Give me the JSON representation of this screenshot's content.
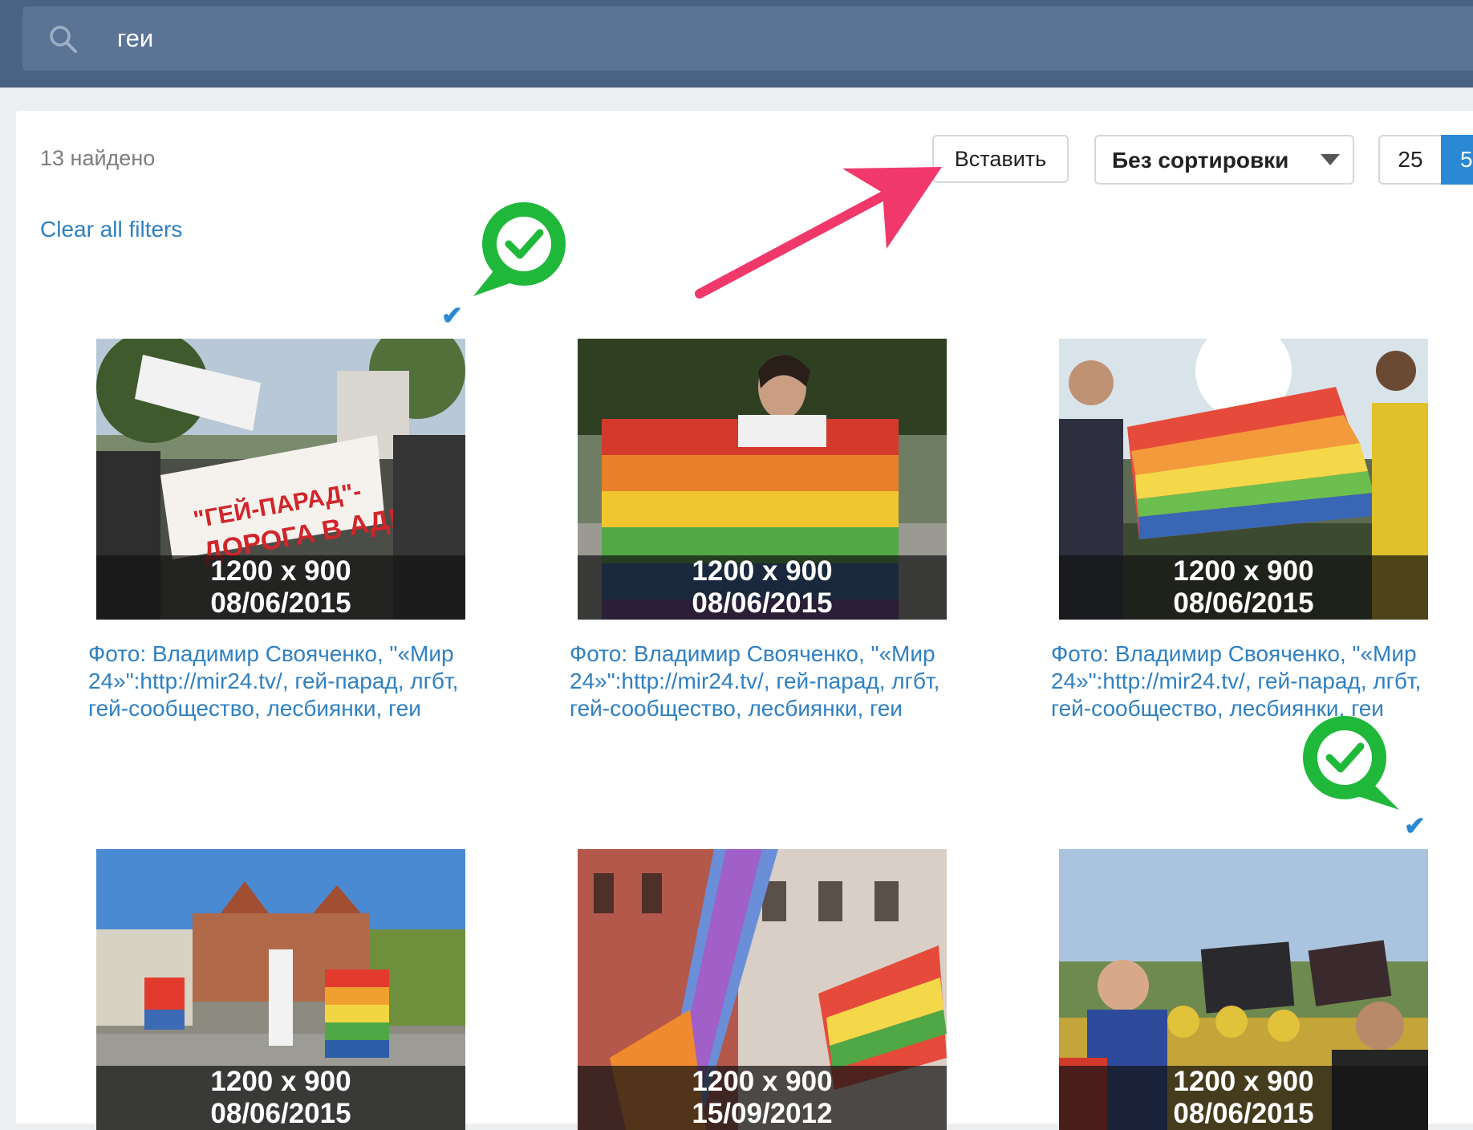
{
  "search": {
    "query": "геи",
    "icon": "search-icon"
  },
  "results": {
    "count_text": "13 найдено",
    "clear_filters": "Clear all filters",
    "insert_label": "Вставить",
    "sort": {
      "selected": "Без сортировки",
      "icon": "chevron-down-icon"
    },
    "page_sizes": [
      "25",
      "5"
    ],
    "active_page_size": "5"
  },
  "cards": [
    {
      "size": "1200 x 900",
      "date": "08/06/2015",
      "caption": "Фото: Владимир Свояченко, \"«Мир 24»\":http://mir24.tv/, гей-парад, лгбт, гей-сообщество, лесбиянки, геи",
      "selected": true,
      "image": "protest-banner-photo"
    },
    {
      "size": "1200 x 900",
      "date": "08/06/2015",
      "caption": "Фото: Владимир Свояченко, \"«Мир 24»\":http://mir24.tv/, гей-парад, лгбт, гей-сообщество, лесбиянки, геи",
      "selected": false,
      "image": "man-with-rainbow-flag-photo"
    },
    {
      "size": "1200 x 900",
      "date": "08/06/2015",
      "caption": "Фото: Владимир Свояченко, \"«Мир 24»\":http://mir24.tv/, гей-парад, лгбт, гей-сообщество, лесбиянки, геи",
      "selected": false,
      "image": "people-holding-rainbow-flag-photo"
    },
    {
      "size": "1200 x 900",
      "date": "08/06/2015",
      "caption": "",
      "selected": false,
      "image": "street-march-photo"
    },
    {
      "size": "1200 x 900",
      "date": "15/09/2012",
      "caption": "",
      "selected": false,
      "image": "rainbow-flags-on-street-photo"
    },
    {
      "size": "1200 x 900",
      "date": "08/06/2015",
      "caption": "",
      "selected": true,
      "image": "rally-with-signs-photo"
    }
  ],
  "colors": {
    "header": "#4a6283",
    "link": "#2f80c2",
    "accent": "#2a88d4",
    "arrow": "#f0386b",
    "check_badge": "#1fb83a"
  }
}
